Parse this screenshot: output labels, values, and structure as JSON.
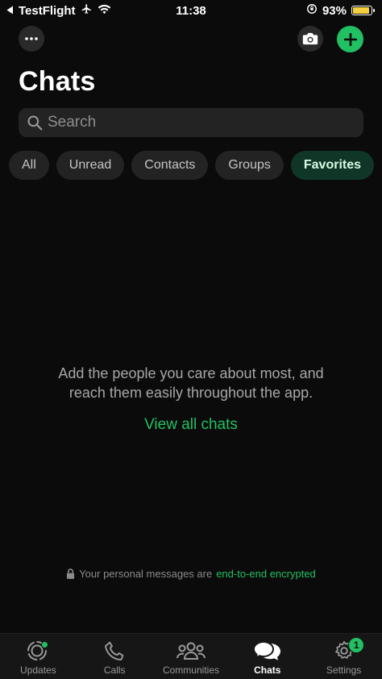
{
  "status_bar": {
    "back_app": "TestFlight",
    "time": "11:38",
    "battery": "93%",
    "battery_level": 0.93,
    "icons": [
      "back-triangle-icon",
      "airplane-icon",
      "wifi-icon",
      "orientation-lock-icon",
      "battery-icon"
    ]
  },
  "header": {
    "title": "Chats",
    "icons": [
      "more-icon",
      "camera-icon",
      "plus-icon"
    ]
  },
  "search": {
    "placeholder": "Search",
    "icon": "search-icon"
  },
  "filters": [
    {
      "label": "All",
      "active": false
    },
    {
      "label": "Unread",
      "active": false
    },
    {
      "label": "Contacts",
      "active": false
    },
    {
      "label": "Groups",
      "active": false
    },
    {
      "label": "Favorites",
      "active": true
    }
  ],
  "empty_state": {
    "line1": "Add the people you care about most, and",
    "line2": "reach them easily throughout the app.",
    "action": "View all chats"
  },
  "encryption": {
    "text": "Your personal messages are",
    "link": "end-to-end encrypted",
    "icon": "lock-icon"
  },
  "tabs": [
    {
      "label": "Updates",
      "icon": "updates-icon",
      "dot": true
    },
    {
      "label": "Calls",
      "icon": "phone-icon"
    },
    {
      "label": "Communities",
      "icon": "communities-icon"
    },
    {
      "label": "Chats",
      "icon": "chats-icon",
      "active": true
    },
    {
      "label": "Settings",
      "icon": "gear-icon",
      "badge": "1"
    }
  ],
  "colors": {
    "accent": "#21c063",
    "background": "#0b0b0b",
    "chip_active_bg": "#103628"
  }
}
